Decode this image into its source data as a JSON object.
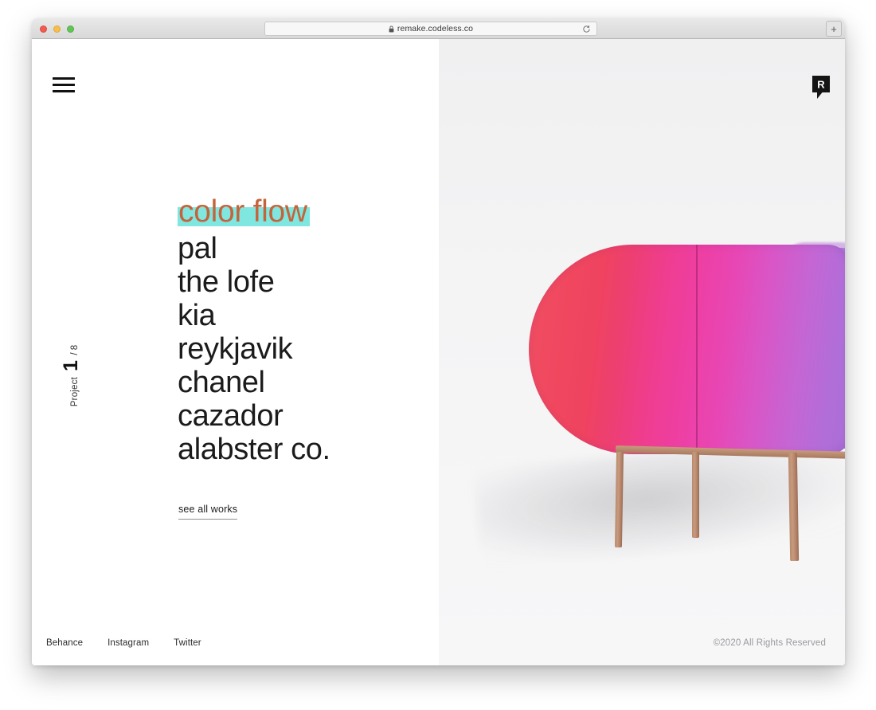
{
  "browser": {
    "url": "remake.codeless.co",
    "lock_icon": "lock-icon",
    "reload_icon": "reload-icon",
    "new_tab_label": "+",
    "traffic_lights": [
      "close-red",
      "minimize-yellow",
      "maximize-green"
    ]
  },
  "site": {
    "menu_icon": "hamburger-menu-icon",
    "logo_icon": "r-bookmark-logo-icon",
    "logo_letter": "R"
  },
  "counter": {
    "label": "Project",
    "index": "1",
    "total": "/ 8"
  },
  "hero": {
    "featured": "color flow",
    "featured_color": "#c4643c",
    "highlight_color": "#7fe7e0",
    "works": [
      "pal",
      "the lofe",
      "kia",
      "reykjavik",
      "chanel",
      "cazador",
      "alabster co."
    ],
    "cta": "see all works"
  },
  "footer": {
    "links": [
      "Behance",
      "Instagram",
      "Twitter"
    ],
    "copyright": "©2020 All Rights Reserved"
  },
  "artwork": {
    "name": "gradient-pill-cabinet",
    "gradient_start": "#ef4f63",
    "gradient_mid": "#ee3fa3",
    "gradient_end": "#a86fd6",
    "leg_color": "#b98a6d",
    "background": "#f4f4f5"
  }
}
